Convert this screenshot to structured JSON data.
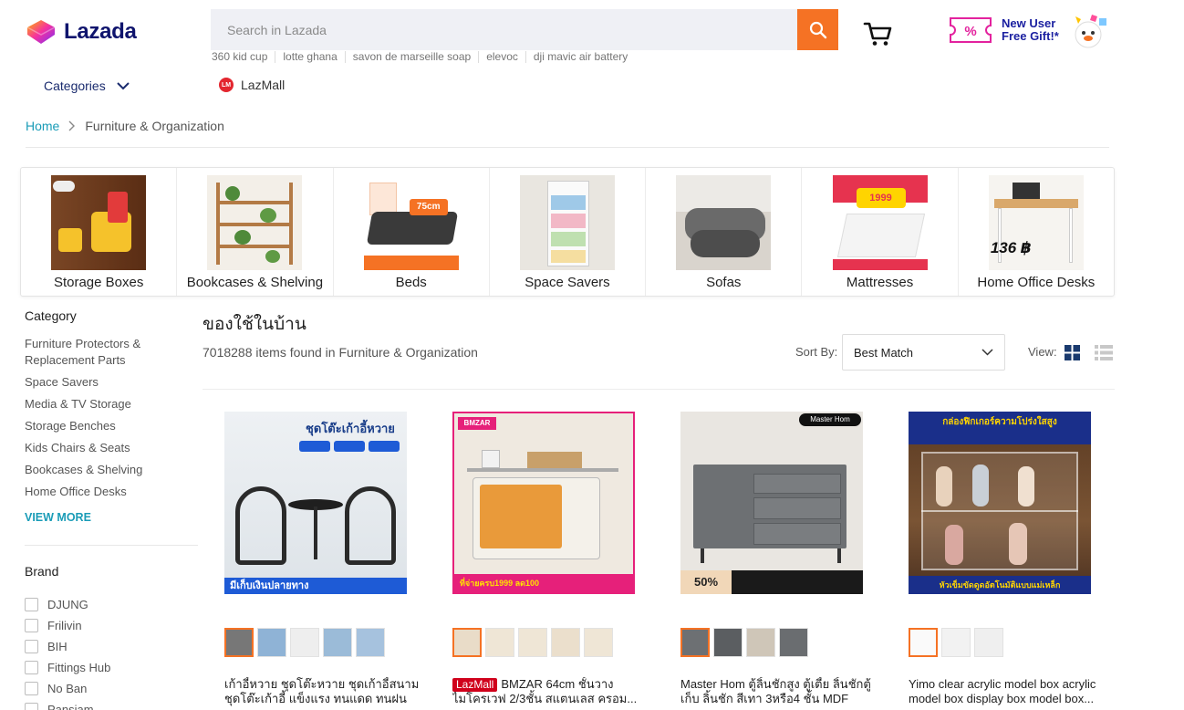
{
  "header": {
    "logo_text": "Lazada",
    "search_placeholder": "Search in Lazada",
    "suggestions": [
      "360 kid cup",
      "lotte ghana",
      "savon de marseille soap",
      "elevoc",
      "dji mavic air battery"
    ],
    "promo_line1": "New User",
    "promo_line2": "Free Gift!*",
    "categories_label": "Categories",
    "lazmall_label": "LazMall",
    "lazmall_badge": "LM"
  },
  "breadcrumb": {
    "home": "Home",
    "current": "Furniture & Organization"
  },
  "category_strip": [
    {
      "label": "Storage Boxes"
    },
    {
      "label": "Bookcases & Shelving"
    },
    {
      "label": "Beds",
      "img_text": "75cm"
    },
    {
      "label": "Space Savers"
    },
    {
      "label": "Sofas"
    },
    {
      "label": "Mattresses",
      "img_text": "1999"
    },
    {
      "label": "Home Office Desks",
      "img_text": "136 ฿"
    }
  ],
  "sidebar": {
    "category_title": "Category",
    "categories": [
      "Furniture Protectors & Replacement Parts",
      "Space Savers",
      "Media & TV Storage",
      "Storage Benches",
      "Kids Chairs & Seats",
      "Bookcases & Shelving",
      "Home Office Desks"
    ],
    "view_more": "VIEW MORE",
    "brand_title": "Brand",
    "brands": [
      "DJUNG",
      "Frilivin",
      "BIH",
      "Fittings Hub",
      "No Ban",
      "Pansiam"
    ]
  },
  "main": {
    "title": "ของใช้ในบ้าน",
    "found_text": "7018288 items found in Furniture & Organization",
    "sort_label": "Sort By:",
    "sort_value": "Best Match",
    "view_label": "View:"
  },
  "products": [
    {
      "name": "เก้าอี้หวาย ชุดโต๊ะหวาย ชุดเก้าอี้สนาม ชุดโต๊ะเก้าอี้ แข็งแรง ทนแดด ทนฝน สีไ...",
      "img_title": "ชุดโต๊ะเก้าอี้หวาย",
      "img_footer": "มีเก็บเงินปลายทาง",
      "badge": ""
    },
    {
      "name": "BMZAR 64cm ชั้นวางไมโครเวฟ 2/3ชั้น สแตนเลส ครอม...",
      "img_title": "BMZAR",
      "img_footer": "ที่จ่ายครบ1999 ลด100",
      "badge": "LazMall"
    },
    {
      "name": "Master Hom ตู้ลิ้นชักสูง ตู้เตี้ย ลิ้นชักตู้เก็บ ลิ้นชัก สีเทา 3หรือ4 ชั้น MDF คุณภาพสู...",
      "img_title": "Master Hom",
      "img_footer": "50%",
      "badge": ""
    },
    {
      "name": "Yimo clear acrylic model box acrylic model box display box model box...",
      "img_title": "กล่องฟิกเกอร์ความโปร่งใสสูง",
      "img_footer": "หัวเข็มขัดดูดอัตโนมัติแบบแม่เหล็ก",
      "badge": ""
    }
  ],
  "colors": {
    "accent": "#f57224",
    "link": "#1a9cb7",
    "navy": "#0f146d",
    "lazmall_red": "#d0011b"
  }
}
